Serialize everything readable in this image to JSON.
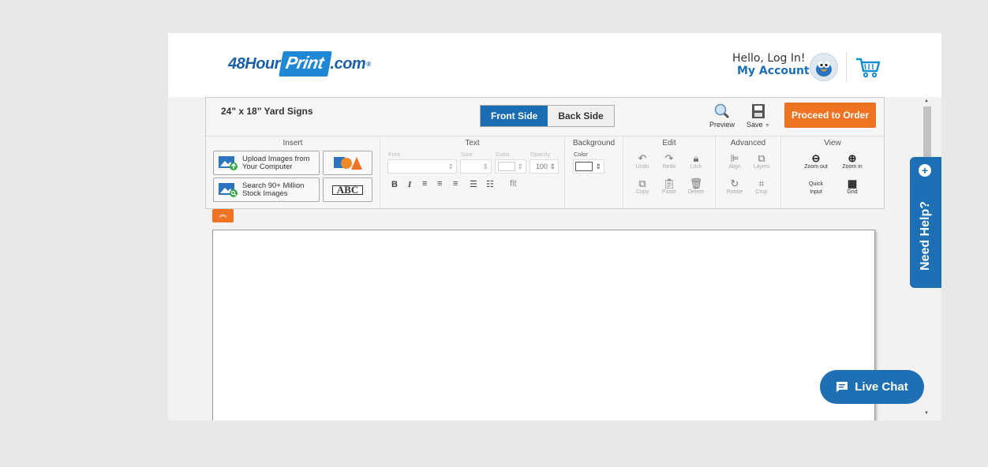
{
  "header": {
    "logo_part1": "48Hour",
    "logo_part2": "Print",
    "logo_part3": ".com",
    "logo_reg": "®",
    "greeting": "Hello, Log In!",
    "account_link": "My Account"
  },
  "editor": {
    "product_title": "24\" x 18\" Yard Signs",
    "front_side": "Front Side",
    "back_side": "Back Side",
    "preview": "Preview",
    "save": "Save",
    "proceed": "Proceed to Order",
    "groups": {
      "insert": "Insert",
      "text": "Text",
      "background": "Background",
      "edit": "Edit",
      "advanced": "Advanced",
      "view": "View"
    },
    "insert": {
      "upload_line1": "Upload Images from",
      "upload_line2": "Your Computer",
      "stock_line1": "Search 90+ Million",
      "stock_line2": "Stock Images",
      "text_tool": "ABC"
    },
    "text": {
      "font_label": "Font",
      "size_label": "Size",
      "color_label": "Color",
      "opacity_label": "Opacity",
      "opacity_value": "100",
      "bold": "B",
      "italic": "I",
      "fit": "fit"
    },
    "background": {
      "color_label": "Color"
    },
    "edit": {
      "undo": "Undo",
      "redo": "Redo",
      "lock": "Lock",
      "copy": "Copy",
      "paste": "Paste",
      "delete": "Delete"
    },
    "advanced": {
      "align": "Align",
      "layers": "Layers",
      "rotate": "Rotate",
      "crop": "Crop"
    },
    "view": {
      "zoom_out": "Zoom out",
      "zoom_in": "Zoom in",
      "quick_input": "Quick Input",
      "grid": "Grid"
    }
  },
  "need_help": "Need Help?",
  "live_chat": "Live Chat"
}
